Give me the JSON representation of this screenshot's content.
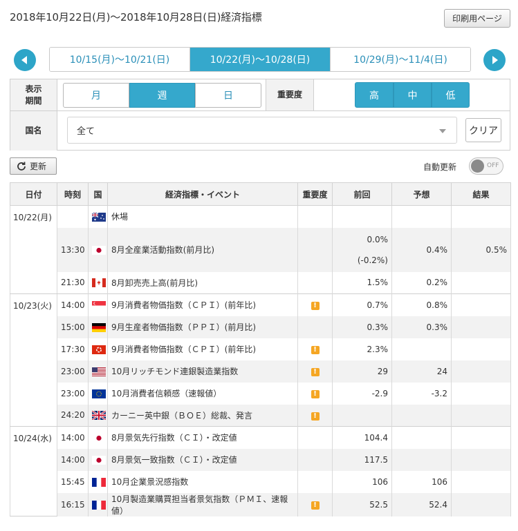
{
  "header": {
    "title": "2018年10月22日(月)～2018年10月28日(日)経済指標",
    "print_label": "印刷用ページ"
  },
  "week_nav": {
    "tabs": [
      "10/15(月)～10/21(日)",
      "10/22(月)～10/28(日)",
      "10/29(月)～11/4(日)"
    ],
    "active_index": 1
  },
  "filters": {
    "display_label": "表示\n期間",
    "display_options": [
      "月",
      "週",
      "日"
    ],
    "display_selected": "週",
    "importance_label": "重要度",
    "importance_options": [
      "高",
      "中",
      "低"
    ],
    "country_label": "国名",
    "country_value": "全て",
    "clear_label": "クリア"
  },
  "controls": {
    "refresh_label": "更新",
    "auto_update_label": "自動更新",
    "toggle_text": "OFF"
  },
  "table": {
    "columns": [
      "日付",
      "時刻",
      "国",
      "経済指標・イベント",
      "重要度",
      "前回",
      "予想",
      "結果"
    ],
    "groups": [
      {
        "date": "10/22(月)",
        "rows": [
          {
            "time": "",
            "flag": "au",
            "event": "休場",
            "important": false,
            "prev": "",
            "prev2": "",
            "forecast": "",
            "result": ""
          },
          {
            "time": "13:30",
            "flag": "jp",
            "event": "8月全産業活動指数(前月比)",
            "important": false,
            "prev": "0.0%",
            "prev2": "(-0.2%)",
            "forecast": "0.4%",
            "result": "0.5%"
          },
          {
            "time": "21:30",
            "flag": "ca",
            "event": "8月卸売売上高(前月比)",
            "important": false,
            "prev": "1.5%",
            "prev2": "",
            "forecast": "0.2%",
            "result": ""
          }
        ]
      },
      {
        "date": "10/23(火)",
        "rows": [
          {
            "time": "14:00",
            "flag": "sg",
            "event": "9月消費者物価指数（ＣＰＩ）(前年比)",
            "important": true,
            "prev": "0.7%",
            "prev2": "",
            "forecast": "0.8%",
            "result": ""
          },
          {
            "time": "15:00",
            "flag": "de",
            "event": "9月生産者物価指数（ＰＰＩ）(前月比)",
            "important": false,
            "prev": "0.3%",
            "prev2": "",
            "forecast": "0.3%",
            "result": ""
          },
          {
            "time": "17:30",
            "flag": "hk",
            "event": "9月消費者物価指数（ＣＰＩ）(前年比)",
            "important": true,
            "prev": "2.3%",
            "prev2": "",
            "forecast": "",
            "result": ""
          },
          {
            "time": "23:00",
            "flag": "us",
            "event": "10月リッチモンド連銀製造業指数",
            "important": true,
            "prev": "29",
            "prev2": "",
            "forecast": "24",
            "result": ""
          },
          {
            "time": "23:00",
            "flag": "eu",
            "event": "10月消費者信頼感（速報値）",
            "important": true,
            "prev": "-2.9",
            "prev2": "",
            "forecast": "-3.2",
            "result": ""
          },
          {
            "time": "24:20",
            "flag": "gb",
            "event": "カーニー英中銀（ＢＯＥ）総裁、発言",
            "important": true,
            "prev": "",
            "prev2": "",
            "forecast": "",
            "result": ""
          }
        ]
      },
      {
        "date": "10/24(水)",
        "rows": [
          {
            "time": "14:00",
            "flag": "jp",
            "event": "8月景気先行指数（ＣＩ）・改定値",
            "important": false,
            "prev": "104.4",
            "prev2": "",
            "forecast": "",
            "result": ""
          },
          {
            "time": "14:00",
            "flag": "jp",
            "event": "8月景気一致指数（ＣＩ）・改定値",
            "important": false,
            "prev": "117.5",
            "prev2": "",
            "forecast": "",
            "result": ""
          },
          {
            "time": "15:45",
            "flag": "fr",
            "event": "10月企業景況感指数",
            "important": false,
            "prev": "106",
            "prev2": "",
            "forecast": "106",
            "result": ""
          },
          {
            "time": "16:15",
            "flag": "fr",
            "event": "10月製造業購買担当者景気指数（ＰＭＩ、速報値）",
            "important": true,
            "prev": "52.5",
            "prev2": "",
            "forecast": "52.4",
            "result": ""
          }
        ]
      }
    ]
  }
}
